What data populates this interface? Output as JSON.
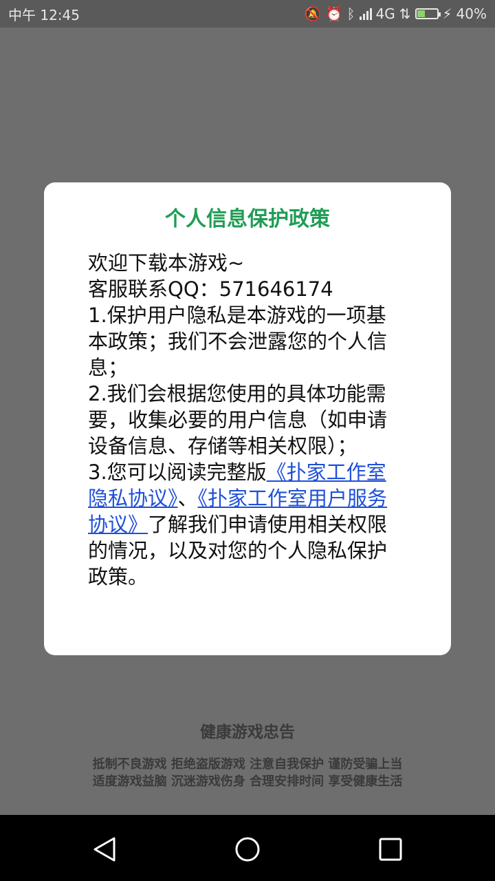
{
  "status_bar": {
    "time": "中午 12:45",
    "network": "4G",
    "battery_percent": "40%",
    "battery_level": 0.4,
    "icons": [
      "bell-off-icon",
      "alarm-icon",
      "bluetooth-icon",
      "signal-icon",
      "data-arrows-icon",
      "battery-icon",
      "charging-icon"
    ]
  },
  "dialog": {
    "title": "个人信息保护政策",
    "body_lines": {
      "greeting": "欢迎下载本游戏~",
      "contact": "客服联系QQ：571646174",
      "item1": "1.保护用户隐私是本游戏的一项基本政策；我们不会泄露您的个人信息；",
      "item2": "2.我们会根据您使用的具体功能需要，收集必要的用户信息（如申请设备信息、存储等相关权限）；",
      "item3_prefix": "3.您可以阅读完整版",
      "link_privacy": "《扑家工作室隐私协议》",
      "separator": "、",
      "link_service": "《扑家工作室用户服务协议》",
      "item3_suffix": "了解我们申请使用相关权限的情况，以及对您的个人隐私保护政策。"
    },
    "colors": {
      "title": "#1f9d55",
      "link": "#1e4fd8"
    }
  },
  "health_warning": {
    "title": "健康游戏忠告",
    "line1": "抵制不良游戏 拒绝盗版游戏 注意自我保护 谨防受骗上当",
    "line2": "适度游戏益脑 沉迷游戏伤身 合理安排时间 享受健康生活"
  },
  "nav_bar": {
    "icons": [
      "back-icon",
      "home-icon",
      "recents-icon"
    ]
  }
}
